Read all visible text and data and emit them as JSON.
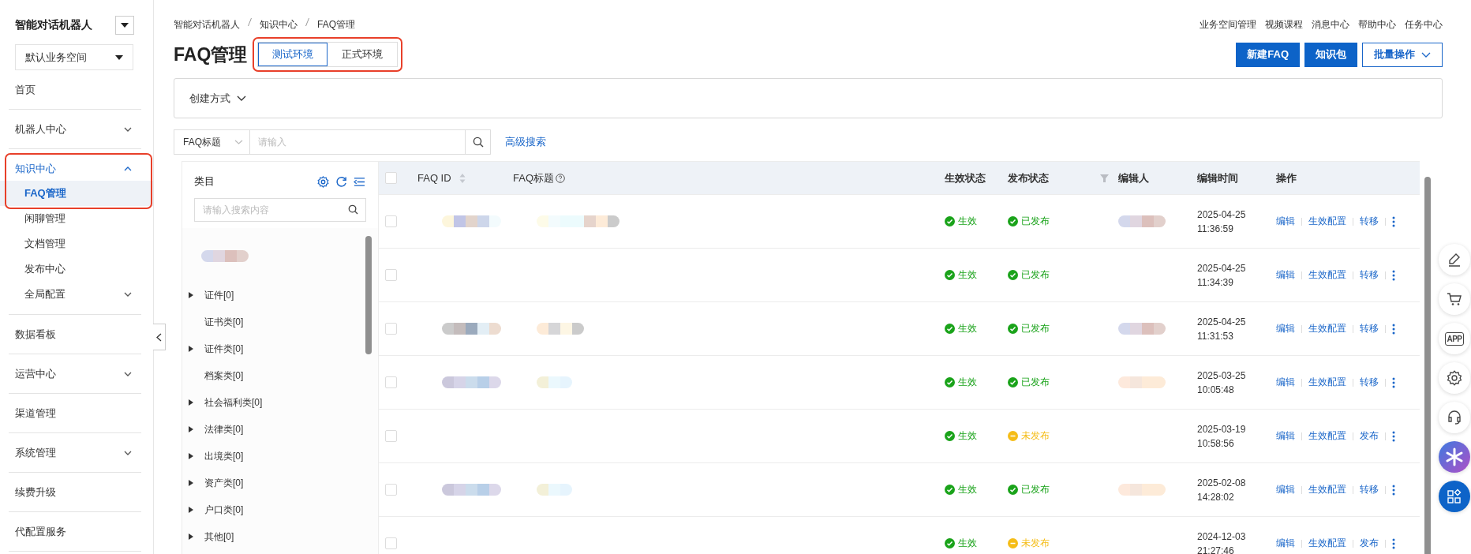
{
  "sidebar": {
    "app_title": "智能对话机器人",
    "workspace": "默认业务空间",
    "items": [
      {
        "label": "首页",
        "selected": false
      },
      {
        "label": "机器人中心",
        "selected": false,
        "expanded": false
      },
      {
        "label": "知识中心",
        "selected": true,
        "expanded": true,
        "highlighted": true,
        "children": [
          {
            "label": "FAQ管理",
            "selected": true,
            "highlighted": true
          },
          {
            "label": "闲聊管理",
            "selected": false
          },
          {
            "label": "文档管理",
            "selected": false
          },
          {
            "label": "发布中心",
            "selected": false
          },
          {
            "label": "全局配置",
            "selected": false,
            "expanded": false
          }
        ]
      },
      {
        "label": "数据看板",
        "selected": false
      },
      {
        "label": "运营中心",
        "selected": false,
        "expanded": false
      },
      {
        "label": "渠道管理",
        "selected": false
      },
      {
        "label": "系统管理",
        "selected": false,
        "expanded": false
      },
      {
        "label": "续费升级",
        "selected": false
      },
      {
        "label": "代配置服务",
        "selected": false
      }
    ]
  },
  "breadcrumb": [
    "智能对话机器人",
    "知识中心",
    "FAQ管理"
  ],
  "top_links": [
    "业务空间管理",
    "视频课程",
    "消息中心",
    "帮助中心",
    "任务中心"
  ],
  "page_title": "FAQ管理",
  "env_tabs": {
    "highlighted": true,
    "tabs": [
      {
        "label": "测试环境",
        "selected": true
      },
      {
        "label": "正式环境",
        "selected": false
      }
    ]
  },
  "actions": [
    {
      "label": "新建FAQ",
      "kind": "primary"
    },
    {
      "label": "知识包",
      "kind": "primary"
    },
    {
      "label": "批量操作",
      "kind": "dropdown"
    }
  ],
  "filter_panel": {
    "label": "创建方式"
  },
  "search": {
    "field": "FAQ标题",
    "placeholder": "请输入",
    "advanced": "高级搜索"
  },
  "categories": {
    "title": "类目",
    "placeholder": "请输入搜索内容",
    "items": [
      {
        "kind": "blurred"
      },
      {
        "kind": "node",
        "label": "证件[0]",
        "expandable": true
      },
      {
        "kind": "node",
        "label": "证书类[0]",
        "expandable": false
      },
      {
        "kind": "node",
        "label": "证件类[0]",
        "expandable": true
      },
      {
        "kind": "node",
        "label": "档案类[0]",
        "expandable": false
      },
      {
        "kind": "node",
        "label": "社会福利类[0]",
        "expandable": true
      },
      {
        "kind": "node",
        "label": "法律类[0]",
        "expandable": true
      },
      {
        "kind": "node",
        "label": "出境类[0]",
        "expandable": true
      },
      {
        "kind": "node",
        "label": "资产类[0]",
        "expandable": true
      },
      {
        "kind": "node",
        "label": "户口类[0]",
        "expandable": true
      },
      {
        "kind": "node",
        "label": "其他[0]",
        "expandable": true
      }
    ]
  },
  "table": {
    "all_checked": false,
    "columns": [
      "FAQ ID",
      "FAQ标题",
      "生效状态",
      "发布状态",
      "编辑人",
      "编辑时间",
      "操作"
    ],
    "rows": [
      {
        "checked": false,
        "id_blurred": true,
        "title_blurred": true,
        "effect": {
          "label": "生效",
          "ok": true
        },
        "publish": {
          "label": "已发布",
          "ok": true
        },
        "editor_blurred": true,
        "date": "2025-04-25",
        "time": "11:36:59",
        "actions": [
          "编辑",
          "生效配置",
          "转移"
        ]
      },
      {
        "checked": false,
        "id_blurred": false,
        "title_blurred": false,
        "effect": {
          "label": "生效",
          "ok": true
        },
        "publish": {
          "label": "已发布",
          "ok": true
        },
        "editor_blurred": false,
        "date": "2025-04-25",
        "time": "11:34:39",
        "actions": [
          "编辑",
          "生效配置",
          "转移"
        ]
      },
      {
        "checked": false,
        "id_blurred": true,
        "title_blurred": true,
        "effect": {
          "label": "生效",
          "ok": true
        },
        "publish": {
          "label": "已发布",
          "ok": true
        },
        "editor_blurred": true,
        "date": "2025-04-25",
        "time": "11:31:53",
        "actions": [
          "编辑",
          "生效配置",
          "转移"
        ]
      },
      {
        "checked": false,
        "id_blurred": true,
        "title_blurred": true,
        "effect": {
          "label": "生效",
          "ok": true
        },
        "publish": {
          "label": "已发布",
          "ok": true
        },
        "editor_blurred": true,
        "date": "2025-03-25",
        "time": "10:05:48",
        "actions": [
          "编辑",
          "生效配置",
          "转移"
        ]
      },
      {
        "checked": false,
        "id_blurred": false,
        "title_blurred": false,
        "effect": {
          "label": "生效",
          "ok": true
        },
        "publish": {
          "label": "未发布",
          "ok": false
        },
        "editor_blurred": false,
        "date": "2025-03-19",
        "time": "10:58:56",
        "actions": [
          "编辑",
          "生效配置",
          "发布"
        ]
      },
      {
        "checked": false,
        "id_blurred": true,
        "title_blurred": true,
        "effect": {
          "label": "生效",
          "ok": true
        },
        "publish": {
          "label": "已发布",
          "ok": true
        },
        "editor_blurred": true,
        "date": "2025-02-08",
        "time": "14:28:02",
        "actions": [
          "编辑",
          "生效配置",
          "转移"
        ]
      },
      {
        "checked": false,
        "id_blurred": false,
        "title_blurred": false,
        "effect": {
          "label": "生效",
          "ok": true
        },
        "publish": {
          "label": "未发布",
          "ok": false
        },
        "editor_blurred": false,
        "date": "2024-12-03",
        "time": "21:27:46",
        "actions": [
          "编辑",
          "生效配置",
          "发布"
        ]
      }
    ]
  },
  "float_tools": [
    {
      "kind": "edit"
    },
    {
      "kind": "cart"
    },
    {
      "kind": "app",
      "label": "APP"
    },
    {
      "kind": "settings"
    },
    {
      "kind": "support"
    },
    {
      "kind": "spark"
    },
    {
      "kind": "apps"
    }
  ]
}
